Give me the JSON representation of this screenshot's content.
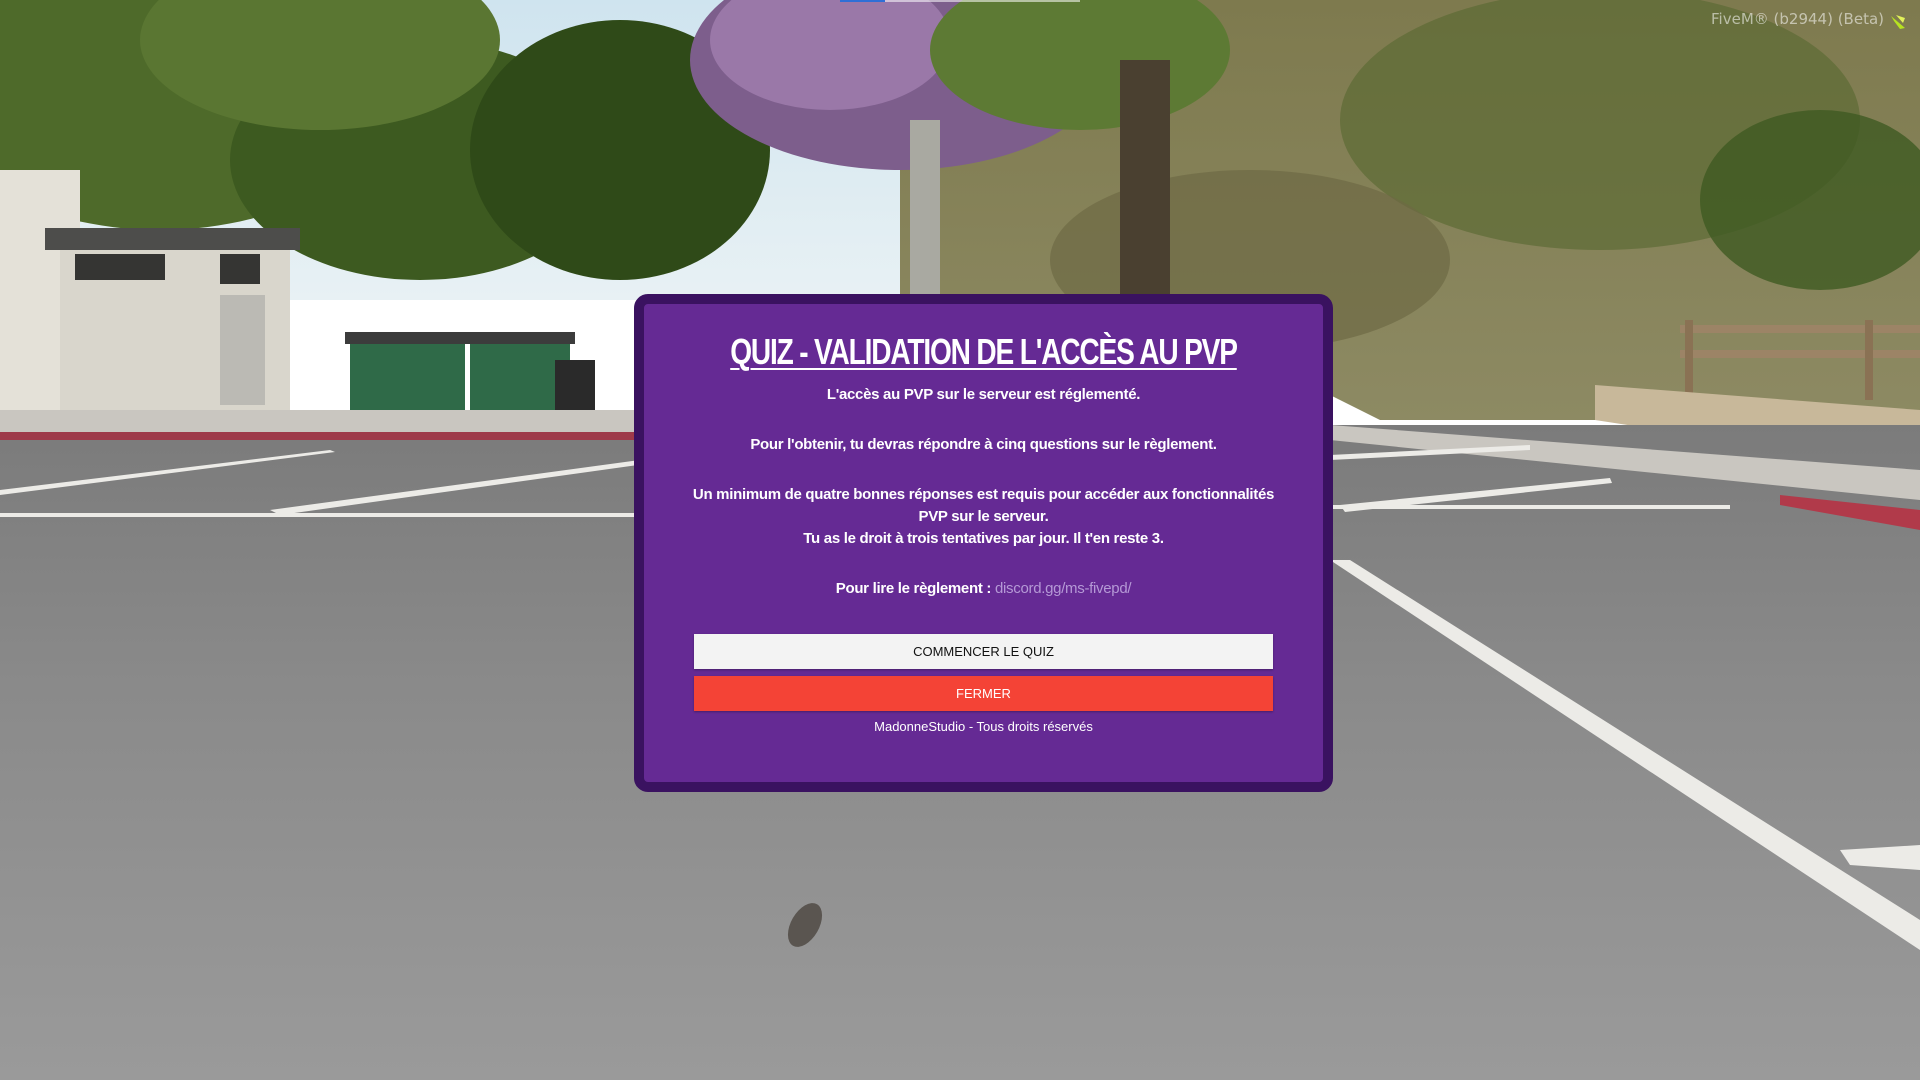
{
  "overlay": {
    "client_tag": "FiveM® (b2944) (Beta)",
    "logo_icon": "fivem-logo-icon"
  },
  "modal": {
    "title": "QUIZ - VALIDATION DE L'ACCÈS AU PVP",
    "intro": "L'accès au PVP sur le serveur est réglementé.",
    "obtain": "Pour l'obtenir, tu devras répondre à cinq questions sur le règlement.",
    "minimum": "Un minimum de quatre bonnes réponses est requis pour accéder aux fonctionnalités PVP sur le serveur.",
    "attempts": "Tu as le droit à trois tentatives par jour. Il t'en reste 3.",
    "rules_label": "Pour lire le règlement :",
    "rules_link": "discord.gg/ms-fivepd/",
    "start_button": "COMMENCER LE QUIZ",
    "close_button": "FERMER",
    "footer": "MadonneStudio - Tous droits réservés"
  },
  "colors": {
    "modal_bg": "#652a94",
    "modal_border": "#3a1260",
    "start_button_bg": "#f3f3f3",
    "close_button_bg": "#f44336",
    "link": "#b599d6"
  }
}
